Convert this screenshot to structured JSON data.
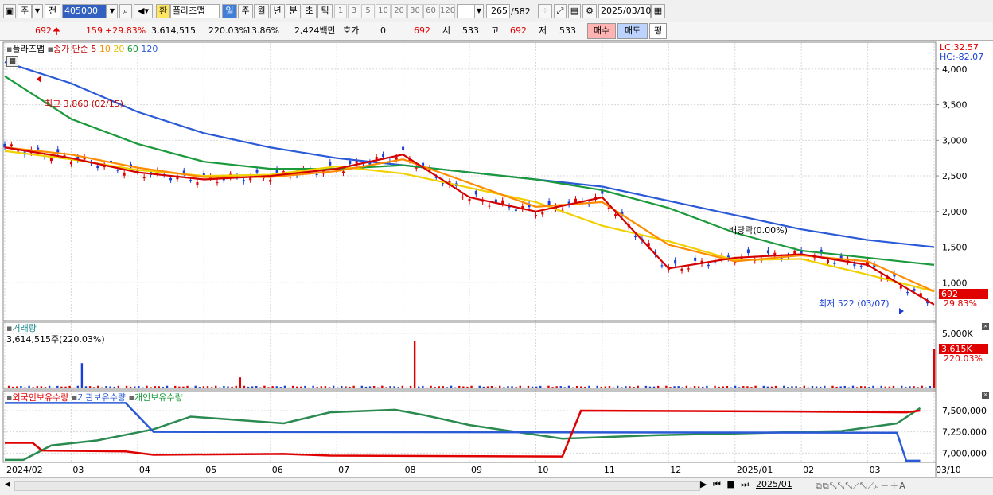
{
  "toolbar": {
    "cell1": "주",
    "cell2": "전",
    "code": "405000",
    "name_prefix": "환",
    "stock_name": "플라즈맵",
    "periods": [
      "일",
      "주",
      "월",
      "년",
      "분",
      "초",
      "틱"
    ],
    "numbers": [
      "1",
      "3",
      "5",
      "10",
      "20",
      "30",
      "60",
      "120"
    ],
    "count": "265",
    "total": "/582",
    "date": "2025/03/10"
  },
  "quote": {
    "price": "692",
    "change": "159",
    "change_pct": "+29.83%",
    "volume": "3,614,515",
    "volume_pct": "220.03%",
    "turnover": "13.86%",
    "amount": "2,424백만",
    "hoga_label": "호가",
    "hoga_value": "0",
    "hoga_price": "692",
    "open_label": "시",
    "open": "533",
    "high_label": "고",
    "high": "692",
    "low_label": "저",
    "low": "533",
    "buy": "매수",
    "sell": "매도",
    "avg": "평"
  },
  "colors": {
    "up": "#e00000",
    "down": "#1a3fd6",
    "ma5": "#d40000",
    "ma10": "#ff8c00",
    "ma20": "#f0d000",
    "ma60": "#1a9a3a",
    "ma120": "#2a5ad6",
    "grid": "#d8d8d8",
    "vol_up": "#e00000",
    "vol_down": "#1a3fd6"
  },
  "price_panel": {
    "name": "플라즈맵",
    "ma_label": "종가 단순",
    "ma": [
      "5",
      "10",
      "20",
      "60",
      "120"
    ],
    "lc": "LC:32.57",
    "hc": "HC:-82.07",
    "high_note": "최고 3,860 (02/15)",
    "low_note": "최저 522 (03/07)",
    "dividend_note": "배당락(0.00%)",
    "last_price": "692",
    "last_pct": "29.83%",
    "y_ticks": [
      "4,000",
      "3,500",
      "3,000",
      "2,500",
      "2,000",
      "1,500",
      "1,000"
    ]
  },
  "volume_panel": {
    "title": "거래량",
    "info": "3,614,515주(220.03%)",
    "y_ticks": [
      "5,000K"
    ],
    "last": "3,615K",
    "last_pct": "220.03%"
  },
  "holdings_panel": {
    "series": [
      "외국인보유수량",
      "기관보유수량",
      "개인보유수량"
    ],
    "y_ticks": [
      "7,500,000",
      "7,250,000",
      "7,000,000"
    ]
  },
  "x_axis": [
    "2024/02",
    "03",
    "04",
    "05",
    "06",
    "07",
    "08",
    "09",
    "10",
    "11",
    "12",
    "2025/01",
    "02",
    "03",
    "03/10"
  ],
  "chart_data": [
    {
      "type": "line",
      "title": "플라즈맵",
      "series_names": [
        "종가 단순 5",
        "10",
        "20",
        "60",
        "120"
      ],
      "ylim": [
        500,
        4300
      ],
      "months": [
        "2024/02",
        "03",
        "04",
        "05",
        "06",
        "07",
        "08",
        "09",
        "10",
        "11",
        "12",
        "2025/01",
        "02",
        "03"
      ],
      "close_approx": [
        2900,
        2750,
        2550,
        2450,
        2500,
        2600,
        2800,
        2200,
        2000,
        2200,
        1200,
        1350,
        1400,
        1250,
        692
      ],
      "ma120_approx": [
        4100,
        3800,
        3400,
        3100,
        2900,
        2750,
        2650,
        2550,
        2450,
        2350,
        2150,
        1950,
        1750,
        1600,
        1500
      ],
      "ma60_approx": [
        3900,
        3300,
        2950,
        2700,
        2600,
        2600,
        2650,
        2550,
        2450,
        2300,
        2050,
        1700,
        1450,
        1350,
        1250
      ],
      "high": {
        "value": 3860,
        "date": "02/15"
      },
      "low": {
        "value": 522,
        "date": "03/07"
      },
      "last": 692
    },
    {
      "type": "bar",
      "title": "거래량",
      "last_value_k": 3615,
      "ylim_k": [
        0,
        5500
      ]
    },
    {
      "type": "line",
      "title": "보유수량",
      "series_names": [
        "외국인보유수량",
        "기관보유수량",
        "개인보유수량"
      ],
      "ylim": [
        6900000,
        7650000
      ]
    }
  ],
  "footer": {
    "date_nav": "2025/01"
  }
}
